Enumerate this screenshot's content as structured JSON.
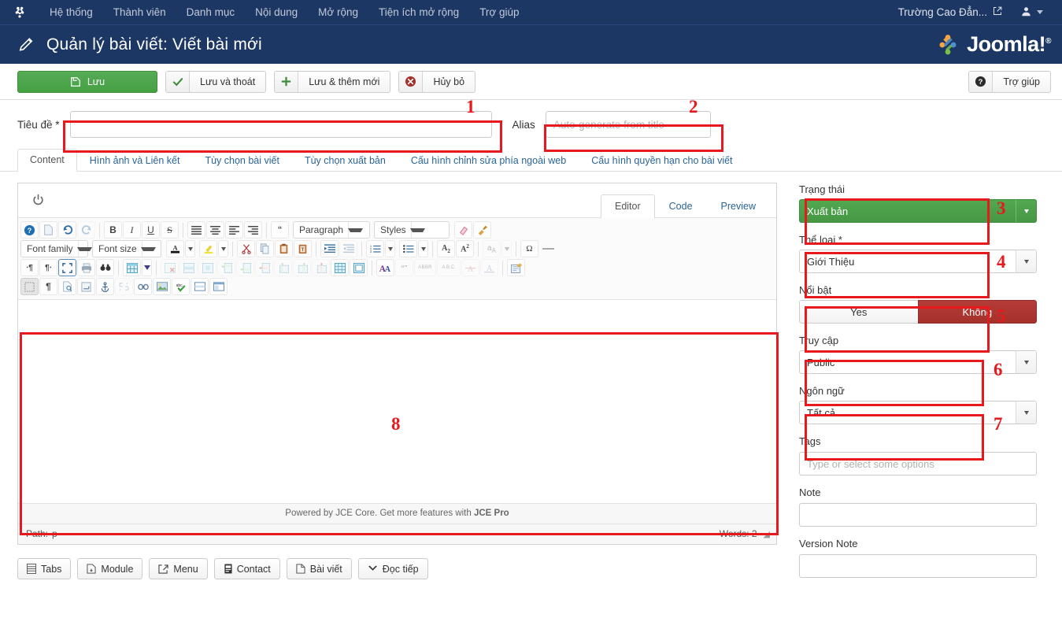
{
  "topbar": {
    "logo_icon": "joomla-logo-icon",
    "menu": [
      {
        "label": "Hệ thống"
      },
      {
        "label": "Thành viên"
      },
      {
        "label": "Danh mục"
      },
      {
        "label": "Nội dung"
      },
      {
        "label": "Mở rộng"
      },
      {
        "label": "Tiện ích mở rộng"
      },
      {
        "label": "Trợ giúp"
      }
    ],
    "site_name": "Trường Cao Đẳn...",
    "site_icon": "external-link-icon",
    "user_icon": "user-icon"
  },
  "header": {
    "icon": "pencil-icon",
    "title": "Quản lý bài viết: Viết bài mới",
    "brand": "Joomla!",
    "brand_reg": "®"
  },
  "toolbar": {
    "save": {
      "label": "Lưu",
      "icon": "save-disk-icon"
    },
    "save_close": {
      "label": "Lưu và thoát",
      "icon": "check-icon"
    },
    "save_new": {
      "label": "Lưu & thêm mới",
      "icon": "plus-icon"
    },
    "cancel": {
      "label": "Hủy bỏ",
      "icon": "cancel-circle-icon"
    },
    "help": {
      "label": "Trợ giúp",
      "icon": "question-circle-icon"
    }
  },
  "form": {
    "title_label": "Tiêu đề *",
    "title_value": "",
    "title_placeholder": "",
    "alias_label": "Alias",
    "alias_value": "",
    "alias_placeholder": "Auto-generate from title"
  },
  "tabs": [
    {
      "label": "Content",
      "active": true
    },
    {
      "label": "Hình ảnh và Liên kết",
      "active": false
    },
    {
      "label": "Tùy chọn bài viết",
      "active": false
    },
    {
      "label": "Tùy chọn xuất bản",
      "active": false
    },
    {
      "label": "Cấu hình chỉnh sửa phía ngoài web",
      "active": false
    },
    {
      "label": "Cấu hình quyền hạn cho bài viết",
      "active": false
    }
  ],
  "editor": {
    "toggle_icon": "power-toggle-icon",
    "modes": [
      {
        "label": "Editor",
        "active": true
      },
      {
        "label": "Code",
        "active": false
      },
      {
        "label": "Preview",
        "active": false
      }
    ],
    "paragraph_select": "Paragraph",
    "styles_select": "Styles",
    "fontfamily_select": "Font family",
    "fontsize_select": "Font size",
    "content": "",
    "credit_prefix": "Powered by JCE Core. Get more features with ",
    "credit_link": "JCE Pro",
    "path_label": "Path:",
    "path_value": "p",
    "words_label": "Words: 2",
    "resize_icon": "resize-grip-icon",
    "toolbar_rows": [
      [
        {
          "n": "help-icon",
          "g": "?"
        },
        {
          "n": "new-document-icon",
          "g": "▢"
        },
        {
          "n": "undo-icon",
          "g": "↺"
        },
        {
          "n": "redo-icon",
          "g": "↻",
          "dis": true
        },
        {
          "sep": true
        },
        {
          "n": "bold-icon",
          "g": "B"
        },
        {
          "n": "italic-icon",
          "g": "I"
        },
        {
          "n": "underline-icon",
          "g": "U"
        },
        {
          "n": "strikethrough-icon",
          "g": "S"
        },
        {
          "n": "align-justify-icon",
          "g": "≣"
        },
        {
          "n": "align-center-icon",
          "g": "≡"
        },
        {
          "n": "align-left-icon",
          "g": "≡"
        },
        {
          "n": "align-right-icon",
          "g": "≡"
        },
        {
          "sep": true
        },
        {
          "n": "blockquote-icon",
          "g": "❝"
        }
      ],
      [
        {
          "n": "cut-icon",
          "g": "✄"
        },
        {
          "n": "copy-icon",
          "g": "⎘"
        },
        {
          "n": "paste-icon",
          "g": "📋"
        },
        {
          "n": "paste-text-icon",
          "g": "T"
        },
        {
          "n": "indent-icon",
          "g": "⇥"
        },
        {
          "n": "outdent-icon",
          "g": "⇤",
          "dis": true
        },
        {
          "n": "numbered-list-icon",
          "g": "1≡"
        },
        {
          "n": "bullet-list-icon",
          "g": "•≡"
        },
        {
          "n": "subscript-icon",
          "g": "A₂"
        },
        {
          "n": "superscript-icon",
          "g": "A²"
        },
        {
          "n": "spellcheck-icon",
          "g": "a",
          "dis": true
        },
        {
          "n": "special-character-icon",
          "g": "Ω"
        },
        {
          "n": "horizontal-rule-icon",
          "g": "—"
        }
      ],
      [
        {
          "n": "ltr-icon",
          "g": "¶"
        },
        {
          "n": "rtl-icon",
          "g": "¶"
        },
        {
          "n": "fullscreen-icon",
          "g": "⛶"
        },
        {
          "n": "print-icon",
          "g": "🖨"
        },
        {
          "n": "preview-icon",
          "g": "👓"
        },
        {
          "sep": true
        },
        {
          "n": "insert-table-icon",
          "g": "▦"
        },
        {
          "n": "delete-table-icon",
          "g": "▦",
          "dis": true
        },
        {
          "n": "table-row-props-icon",
          "g": "▤",
          "dis": true
        },
        {
          "n": "table-cell-props-icon",
          "g": "▣",
          "dis": true
        },
        {
          "n": "insert-row-before-icon",
          "g": "▤",
          "dis": true
        },
        {
          "n": "insert-row-after-icon",
          "g": "▤",
          "dis": true
        },
        {
          "n": "delete-row-icon",
          "g": "▤",
          "dis": true
        },
        {
          "n": "insert-col-before-icon",
          "g": "▥",
          "dis": true
        },
        {
          "n": "insert-col-after-icon",
          "g": "▥",
          "dis": true
        },
        {
          "n": "delete-col-icon",
          "g": "▥",
          "dis": true
        },
        {
          "n": "split-cells-icon",
          "g": "▦"
        },
        {
          "n": "merge-cells-icon",
          "g": "▢"
        },
        {
          "n": "font-color-icon",
          "g": "A"
        },
        {
          "n": "quote-icon",
          "g": "❞",
          "dis": true
        },
        {
          "n": "abbr-icon",
          "g": "ABBR",
          "dis": true
        },
        {
          "n": "acronym-icon",
          "g": "A.B.C.",
          "dis": true
        },
        {
          "n": "delete-text-icon",
          "g": "A",
          "dis": true
        },
        {
          "n": "insert-text-icon",
          "g": "A",
          "dis": true
        },
        {
          "n": "source-code-icon",
          "g": "✎"
        }
      ],
      [
        {
          "n": "visual-blocks-icon",
          "g": "▦",
          "pressed": true
        },
        {
          "n": "paragraph-marks-icon",
          "g": "¶"
        },
        {
          "n": "article-link-icon",
          "g": "🗎"
        },
        {
          "n": "page-break-icon",
          "g": "⎵"
        },
        {
          "n": "anchor-icon",
          "g": "⚓"
        },
        {
          "n": "unlink-icon",
          "g": "⛓",
          "dis": true
        },
        {
          "n": "link-icon",
          "g": "🔗"
        },
        {
          "n": "image-manager-icon",
          "g": "🖼"
        },
        {
          "n": "spellchecker-icon",
          "g": "abc"
        },
        {
          "n": "readmore-icon",
          "g": "▭"
        },
        {
          "n": "pagebreak-icon",
          "g": "▣"
        }
      ]
    ]
  },
  "xtd_buttons": [
    {
      "label": "Tabs",
      "icon": "tabs-icon"
    },
    {
      "label": "Module",
      "icon": "module-icon"
    },
    {
      "label": "Menu",
      "icon": "menu-icon"
    },
    {
      "label": "Contact",
      "icon": "contact-icon"
    },
    {
      "label": "Bài viết",
      "icon": "article-icon"
    },
    {
      "label": "Đọc tiếp",
      "icon": "readmore-chevron-icon"
    }
  ],
  "sidebar": {
    "status": {
      "label": "Trạng thái",
      "value": "Xuất bản"
    },
    "category": {
      "label": "Thể loại *",
      "value": "Giới Thiệu"
    },
    "featured": {
      "label": "Nổi bật",
      "yes": "Yes",
      "no": "Không",
      "selected": "Không"
    },
    "access": {
      "label": "Truy cập",
      "value": "Public"
    },
    "language": {
      "label": "Ngôn ngữ",
      "value": "Tất cả"
    },
    "tags": {
      "label": "Tags",
      "value": "",
      "placeholder": "Type or select some options"
    },
    "note": {
      "label": "Note",
      "value": ""
    },
    "version_note": {
      "label": "Version Note",
      "value": ""
    }
  },
  "annotations": [
    {
      "num": "1",
      "target": "title-field"
    },
    {
      "num": "2",
      "target": "alias-field"
    },
    {
      "num": "3",
      "target": "status-field"
    },
    {
      "num": "4",
      "target": "category-field"
    },
    {
      "num": "5",
      "target": "featured-field"
    },
    {
      "num": "6",
      "target": "access-field"
    },
    {
      "num": "7",
      "target": "language-field"
    },
    {
      "num": "8",
      "target": "editor-body"
    }
  ],
  "colors": {
    "brand_navy": "#1c3764",
    "annotation_red": "#e8191c",
    "success_green": "#45a043",
    "danger_red": "#a4312c",
    "link_blue": "#2a6496"
  }
}
